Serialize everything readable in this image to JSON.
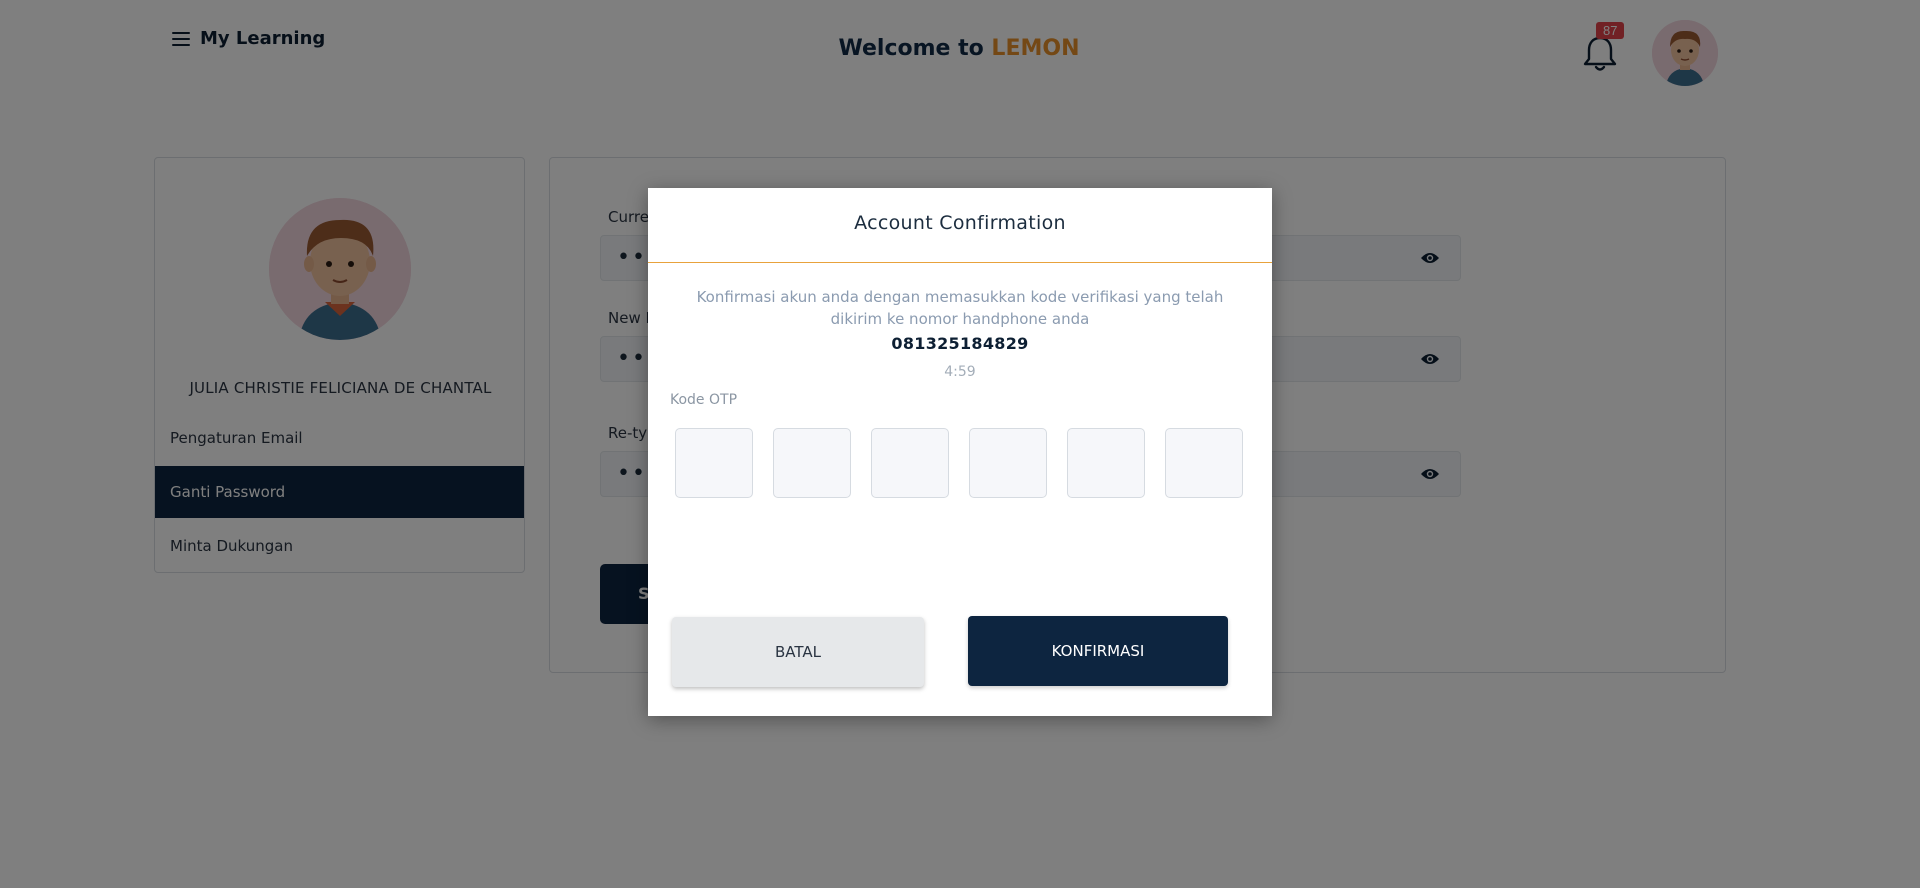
{
  "header": {
    "menu_label": "My Learning",
    "welcome_prefix": "Welcome to ",
    "brand": "LEMON",
    "notification_count": "87"
  },
  "sidebar": {
    "user_name": "JULIA CHRISTIE FELICIANA DE CHANTAL",
    "items": [
      {
        "label": "Pengaturan Email",
        "active": false
      },
      {
        "label": "Ganti Password",
        "active": true
      },
      {
        "label": "Minta Dukungan",
        "active": false
      }
    ]
  },
  "form": {
    "fields": [
      {
        "label": "Current Password",
        "value": "••••••••"
      },
      {
        "label": "New Password",
        "value": "••••••••"
      },
      {
        "label": "Re-type New Password",
        "value": "••••••••"
      }
    ],
    "submit_label": "SIMPAN"
  },
  "modal": {
    "title": "Account Confirmation",
    "description": "Konfirmasi akun anda dengan memasukkan kode verifikasi yang telah dikirim ke nomor handphone anda",
    "phone": "081325184829",
    "timer": "4:59",
    "otp_label": "Kode OTP",
    "otp_values": [
      "",
      "",
      "",
      "",
      "",
      ""
    ],
    "cancel_label": "BATAL",
    "confirm_label": "KONFIRMASI"
  },
  "colors": {
    "brand_accent": "#e8912a",
    "navy": "#0d2540",
    "badge": "#e3424a",
    "divider": "#e8a23c"
  }
}
